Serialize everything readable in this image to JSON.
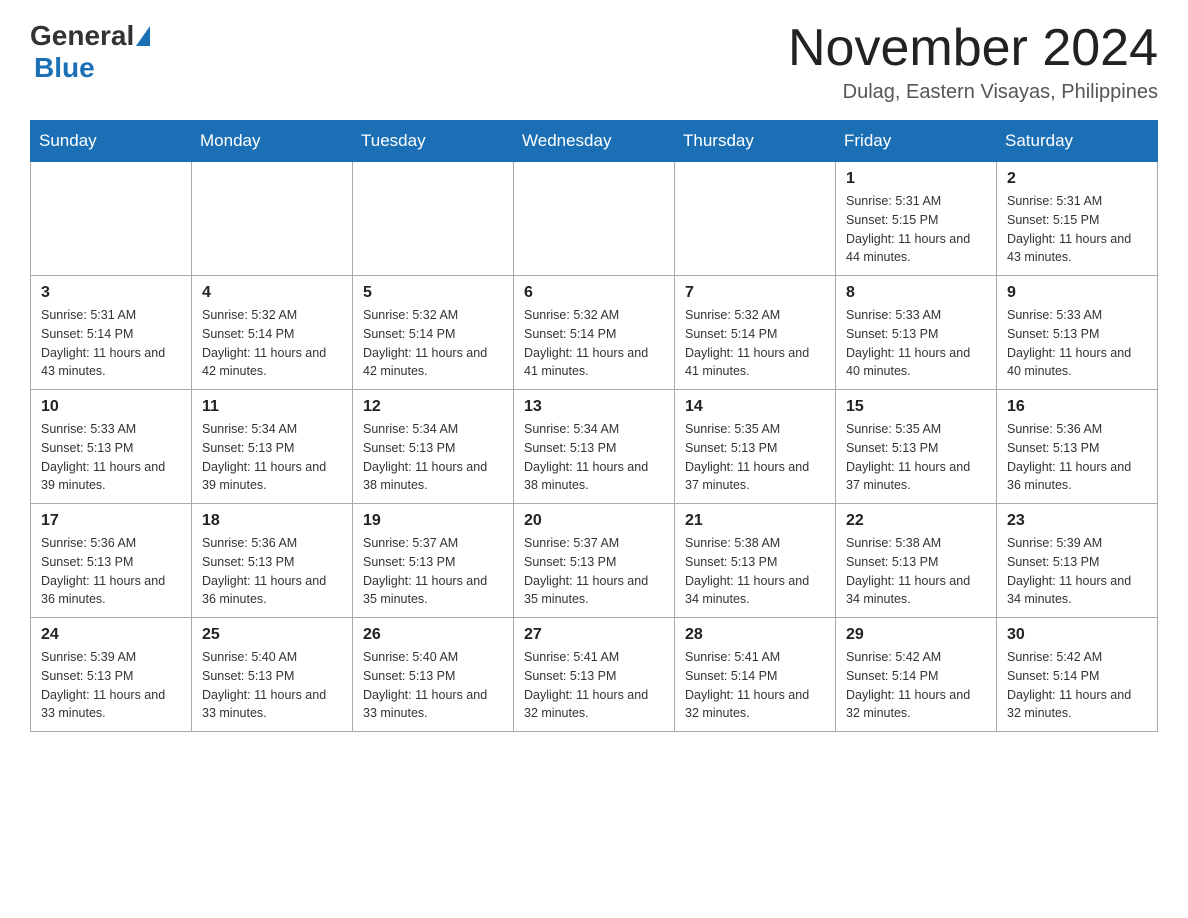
{
  "header": {
    "logo_general": "General",
    "logo_blue": "Blue",
    "title": "November 2024",
    "location": "Dulag, Eastern Visayas, Philippines"
  },
  "calendar": {
    "days_of_week": [
      "Sunday",
      "Monday",
      "Tuesday",
      "Wednesday",
      "Thursday",
      "Friday",
      "Saturday"
    ],
    "weeks": [
      [
        {
          "day": "",
          "info": ""
        },
        {
          "day": "",
          "info": ""
        },
        {
          "day": "",
          "info": ""
        },
        {
          "day": "",
          "info": ""
        },
        {
          "day": "",
          "info": ""
        },
        {
          "day": "1",
          "info": "Sunrise: 5:31 AM\nSunset: 5:15 PM\nDaylight: 11 hours and 44 minutes."
        },
        {
          "day": "2",
          "info": "Sunrise: 5:31 AM\nSunset: 5:15 PM\nDaylight: 11 hours and 43 minutes."
        }
      ],
      [
        {
          "day": "3",
          "info": "Sunrise: 5:31 AM\nSunset: 5:14 PM\nDaylight: 11 hours and 43 minutes."
        },
        {
          "day": "4",
          "info": "Sunrise: 5:32 AM\nSunset: 5:14 PM\nDaylight: 11 hours and 42 minutes."
        },
        {
          "day": "5",
          "info": "Sunrise: 5:32 AM\nSunset: 5:14 PM\nDaylight: 11 hours and 42 minutes."
        },
        {
          "day": "6",
          "info": "Sunrise: 5:32 AM\nSunset: 5:14 PM\nDaylight: 11 hours and 41 minutes."
        },
        {
          "day": "7",
          "info": "Sunrise: 5:32 AM\nSunset: 5:14 PM\nDaylight: 11 hours and 41 minutes."
        },
        {
          "day": "8",
          "info": "Sunrise: 5:33 AM\nSunset: 5:13 PM\nDaylight: 11 hours and 40 minutes."
        },
        {
          "day": "9",
          "info": "Sunrise: 5:33 AM\nSunset: 5:13 PM\nDaylight: 11 hours and 40 minutes."
        }
      ],
      [
        {
          "day": "10",
          "info": "Sunrise: 5:33 AM\nSunset: 5:13 PM\nDaylight: 11 hours and 39 minutes."
        },
        {
          "day": "11",
          "info": "Sunrise: 5:34 AM\nSunset: 5:13 PM\nDaylight: 11 hours and 39 minutes."
        },
        {
          "day": "12",
          "info": "Sunrise: 5:34 AM\nSunset: 5:13 PM\nDaylight: 11 hours and 38 minutes."
        },
        {
          "day": "13",
          "info": "Sunrise: 5:34 AM\nSunset: 5:13 PM\nDaylight: 11 hours and 38 minutes."
        },
        {
          "day": "14",
          "info": "Sunrise: 5:35 AM\nSunset: 5:13 PM\nDaylight: 11 hours and 37 minutes."
        },
        {
          "day": "15",
          "info": "Sunrise: 5:35 AM\nSunset: 5:13 PM\nDaylight: 11 hours and 37 minutes."
        },
        {
          "day": "16",
          "info": "Sunrise: 5:36 AM\nSunset: 5:13 PM\nDaylight: 11 hours and 36 minutes."
        }
      ],
      [
        {
          "day": "17",
          "info": "Sunrise: 5:36 AM\nSunset: 5:13 PM\nDaylight: 11 hours and 36 minutes."
        },
        {
          "day": "18",
          "info": "Sunrise: 5:36 AM\nSunset: 5:13 PM\nDaylight: 11 hours and 36 minutes."
        },
        {
          "day": "19",
          "info": "Sunrise: 5:37 AM\nSunset: 5:13 PM\nDaylight: 11 hours and 35 minutes."
        },
        {
          "day": "20",
          "info": "Sunrise: 5:37 AM\nSunset: 5:13 PM\nDaylight: 11 hours and 35 minutes."
        },
        {
          "day": "21",
          "info": "Sunrise: 5:38 AM\nSunset: 5:13 PM\nDaylight: 11 hours and 34 minutes."
        },
        {
          "day": "22",
          "info": "Sunrise: 5:38 AM\nSunset: 5:13 PM\nDaylight: 11 hours and 34 minutes."
        },
        {
          "day": "23",
          "info": "Sunrise: 5:39 AM\nSunset: 5:13 PM\nDaylight: 11 hours and 34 minutes."
        }
      ],
      [
        {
          "day": "24",
          "info": "Sunrise: 5:39 AM\nSunset: 5:13 PM\nDaylight: 11 hours and 33 minutes."
        },
        {
          "day": "25",
          "info": "Sunrise: 5:40 AM\nSunset: 5:13 PM\nDaylight: 11 hours and 33 minutes."
        },
        {
          "day": "26",
          "info": "Sunrise: 5:40 AM\nSunset: 5:13 PM\nDaylight: 11 hours and 33 minutes."
        },
        {
          "day": "27",
          "info": "Sunrise: 5:41 AM\nSunset: 5:13 PM\nDaylight: 11 hours and 32 minutes."
        },
        {
          "day": "28",
          "info": "Sunrise: 5:41 AM\nSunset: 5:14 PM\nDaylight: 11 hours and 32 minutes."
        },
        {
          "day": "29",
          "info": "Sunrise: 5:42 AM\nSunset: 5:14 PM\nDaylight: 11 hours and 32 minutes."
        },
        {
          "day": "30",
          "info": "Sunrise: 5:42 AM\nSunset: 5:14 PM\nDaylight: 11 hours and 32 minutes."
        }
      ]
    ]
  }
}
